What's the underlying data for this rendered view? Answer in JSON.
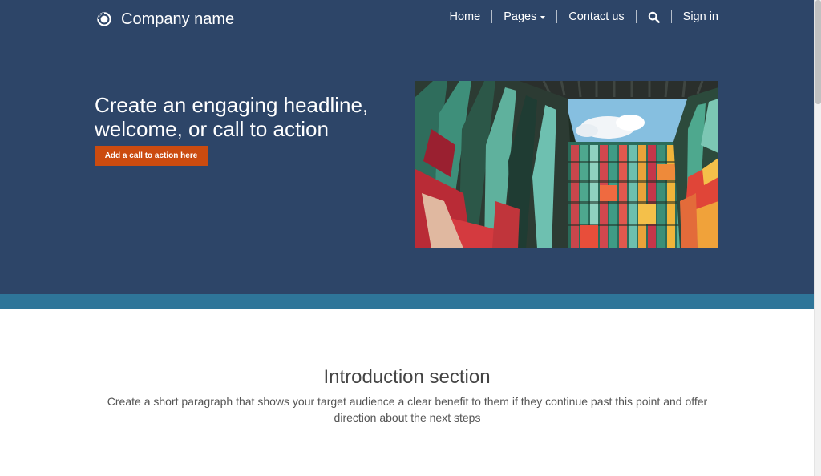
{
  "header": {
    "brand_name": "Company name",
    "logo_icon": "ring-logo-icon",
    "nav": {
      "home": "Home",
      "pages": "Pages",
      "contact": "Contact us",
      "search_icon": "search-icon",
      "sign_in": "Sign in"
    }
  },
  "hero": {
    "headline": "Create an engaging headline, welcome, or call to action",
    "cta_label": "Add a call to action here",
    "image_icon": "colorful-building-image"
  },
  "intro": {
    "title": "Introduction section",
    "text": "Create a short paragraph that shows your target audience a clear benefit to them if they continue past this point and offer direction about the next steps"
  },
  "colors": {
    "header_bg": "#2d4568",
    "stripe": "#2e7599",
    "cta": "#cb4b0f"
  }
}
